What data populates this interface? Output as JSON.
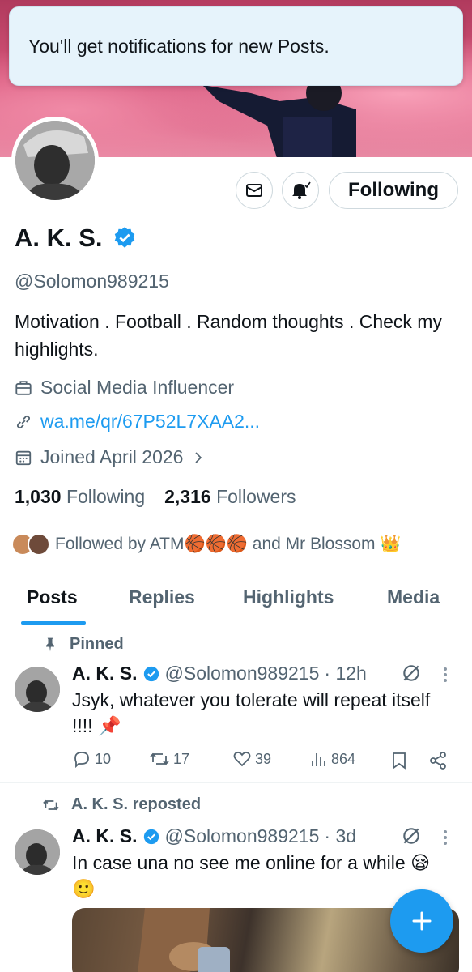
{
  "toast": {
    "text": "You'll get notifications for new Posts."
  },
  "profile": {
    "name": "A. K. S.",
    "handle": "@Solomon989215",
    "bio": "Motivation . Football . Random thoughts . Check my highlights.",
    "category": "Social Media Influencer",
    "link": "wa.me/qr/67P52L7XAA2...",
    "joined": "Joined April 2026",
    "following_count": "1,030",
    "following_label": "Following",
    "followers_count": "2,316",
    "followers_label": "Followers",
    "followed_by": "Followed by ATM🏀🏀🏀 and Mr Blossom 👑",
    "follow_button": "Following"
  },
  "tabs": [
    {
      "label": "Posts",
      "active": true
    },
    {
      "label": "Replies",
      "active": false
    },
    {
      "label": "Highlights",
      "active": false
    },
    {
      "label": "Media",
      "active": false
    }
  ],
  "posts": [
    {
      "context": "Pinned",
      "name": "A. K. S.",
      "handle": "@Solomon989215",
      "time": "· 12h",
      "text": "Jsyk, whatever you tolerate will repeat itself !!!! 📌",
      "replies": "10",
      "reposts": "17",
      "likes": "39",
      "views": "864"
    },
    {
      "context": "A. K. S. reposted",
      "name": "A. K. S.",
      "handle": "@Solomon989215",
      "time": "· 3d",
      "text": "In case una no see me online for a while 😪🙂"
    }
  ],
  "colors": {
    "accent": "#1d9bf0",
    "muted": "#536471",
    "text": "#0f1419"
  },
  "icons": [
    "mail-icon",
    "bell-check-icon",
    "briefcase-icon",
    "link-icon",
    "calendar-icon",
    "chevron-right-icon",
    "pin-icon",
    "verified-icon",
    "grok-icon",
    "more-icon",
    "reply-icon",
    "repost-icon",
    "like-icon",
    "views-icon",
    "bookmark-icon",
    "share-icon",
    "compose-plus-icon"
  ]
}
